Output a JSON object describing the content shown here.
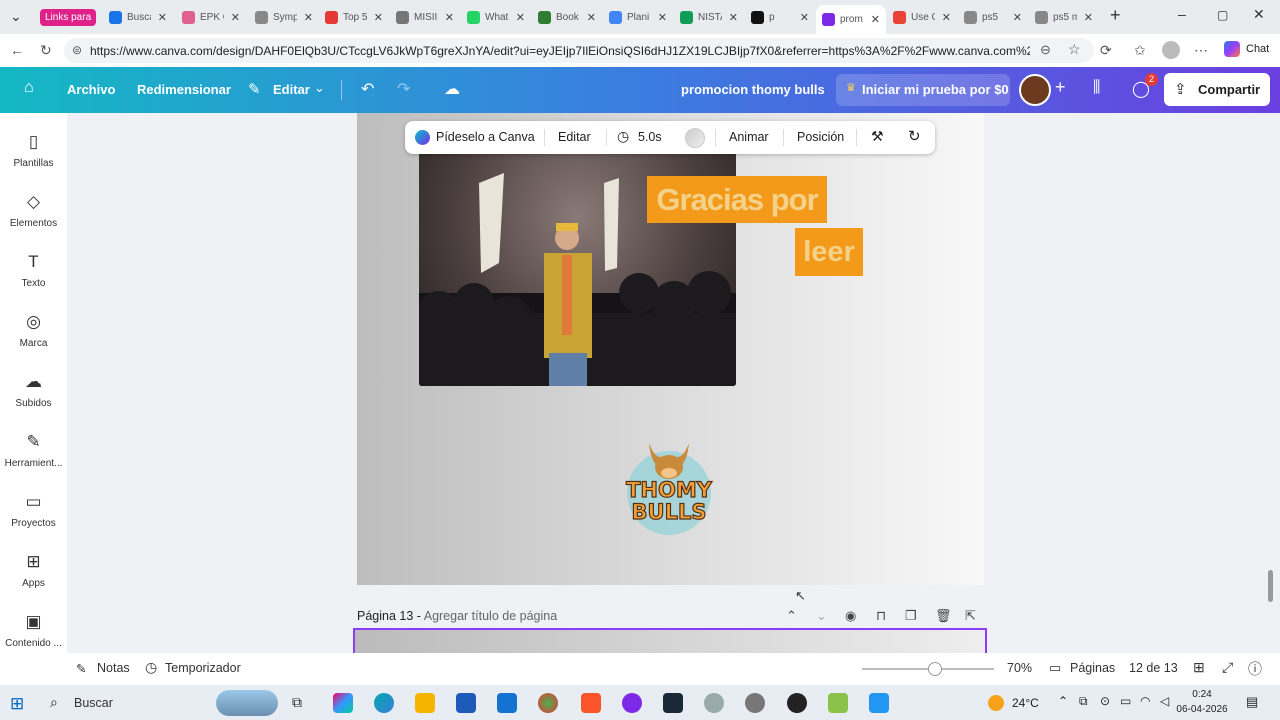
{
  "browser": {
    "tab_group": "Links para",
    "tabs": [
      {
        "label": "Busca",
        "color": "#1a73e8"
      },
      {
        "label": "EPK C",
        "color": "#e06090"
      },
      {
        "label": "Symp",
        "color": "#888888"
      },
      {
        "label": "Top 5",
        "color": "#e53935"
      },
      {
        "label": "MISII",
        "color": "#777777"
      },
      {
        "label": "What",
        "color": "#25d366"
      },
      {
        "label": "Book",
        "color": "#2e7d32"
      },
      {
        "label": "Plani",
        "color": "#4285f4"
      },
      {
        "label": "ÑISTA",
        "color": "#0f9d58"
      },
      {
        "label": "p",
        "color": "#111111"
      },
      {
        "label": "prom",
        "color": "#7d2ae8"
      },
      {
        "label": "Use C",
        "color": "#ea4335"
      },
      {
        "label": "ps5",
        "color": "#888888"
      },
      {
        "label": "ps5 m",
        "color": "#888888"
      }
    ],
    "url": "https://www.canva.com/design/DAHF0ElQb3U/CTccgLV6JkWpT6greXJnYA/edit?ui=eyJEIjp7IlEiOnsiQSI6dHJ1ZX19LCJBIjp7fX0&referrer=https%3A%2F%2Fwww.canva.com%2Fs%2Ftc...",
    "chat_label": "Chat"
  },
  "header": {
    "file": "Archivo",
    "resize": "Redimensionar",
    "edit": "Editar",
    "design_title": "promocion thomy bulls",
    "trial": "Iniciar mi prueba por $0",
    "notifications": "2",
    "share": "Compartir"
  },
  "sidebar": {
    "items": [
      {
        "label": "Plantillas",
        "icon": "▯"
      },
      {
        "label": "Elementos",
        "icon": "◇"
      },
      {
        "label": "Texto",
        "icon": "T"
      },
      {
        "label": "Marca",
        "icon": "◎"
      },
      {
        "label": "Subidos",
        "icon": "☁"
      },
      {
        "label": "Herramient...",
        "icon": "✎"
      },
      {
        "label": "Proyectos",
        "icon": "▭"
      },
      {
        "label": "Apps",
        "icon": "⊞"
      },
      {
        "label": "Contenido ...",
        "icon": "▣"
      }
    ]
  },
  "toolbar": {
    "ask_canva": "Pídeselo a Canva",
    "edit": "Editar",
    "duration": "5.0s",
    "animate": "Animar",
    "position": "Posición"
  },
  "canvas": {
    "text_line1": "Gracias por",
    "text_line2": "leer",
    "logo_line1": "THOMY",
    "logo_line2": "BULLS"
  },
  "next_page": {
    "label": "Página 13 -",
    "placeholder": "Agregar título de página"
  },
  "bottombar": {
    "notes": "Notas",
    "timer": "Temporizador",
    "zoom_percent": 70,
    "zoom": "70%",
    "pages": "Páginas",
    "page_count": "12 de 13"
  },
  "taskbar": {
    "search": "Buscar",
    "weather": "24°C",
    "time": "0:24",
    "date": "06-04-2026"
  }
}
